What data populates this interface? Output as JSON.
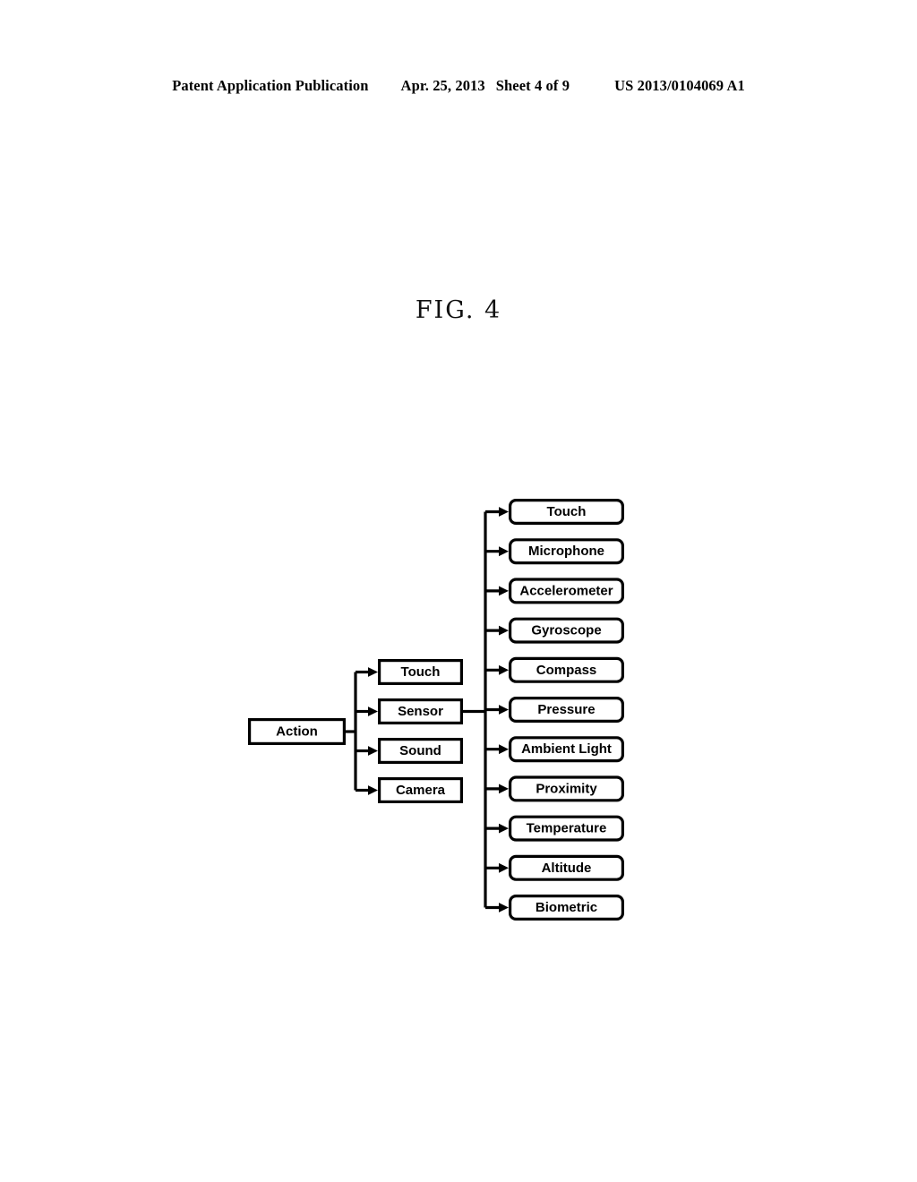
{
  "page_header": {
    "publication": "Patent Application Publication",
    "date": "Apr. 25, 2013",
    "sheet": "Sheet 4 of 9",
    "patent_number": "US 2013/0104069 A1"
  },
  "figure": {
    "label": "FIG. 4",
    "root": {
      "label": "Action"
    },
    "level2": [
      {
        "label": "Touch"
      },
      {
        "label": "Sensor"
      },
      {
        "label": "Sound"
      },
      {
        "label": "Camera"
      }
    ],
    "level3_parent": "Sensor",
    "level3": [
      {
        "label": "Touch"
      },
      {
        "label": "Microphone"
      },
      {
        "label": "Accelerometer"
      },
      {
        "label": "Gyroscope"
      },
      {
        "label": "Compass"
      },
      {
        "label": "Pressure"
      },
      {
        "label": "Ambient Light"
      },
      {
        "label": "Proximity"
      },
      {
        "label": "Temperature"
      },
      {
        "label": "Altitude"
      },
      {
        "label": "Biometric"
      }
    ],
    "colors": {
      "line": "#000000",
      "box_fill": "#ffffff",
      "text": "#000000",
      "background": "#ffffff"
    }
  }
}
